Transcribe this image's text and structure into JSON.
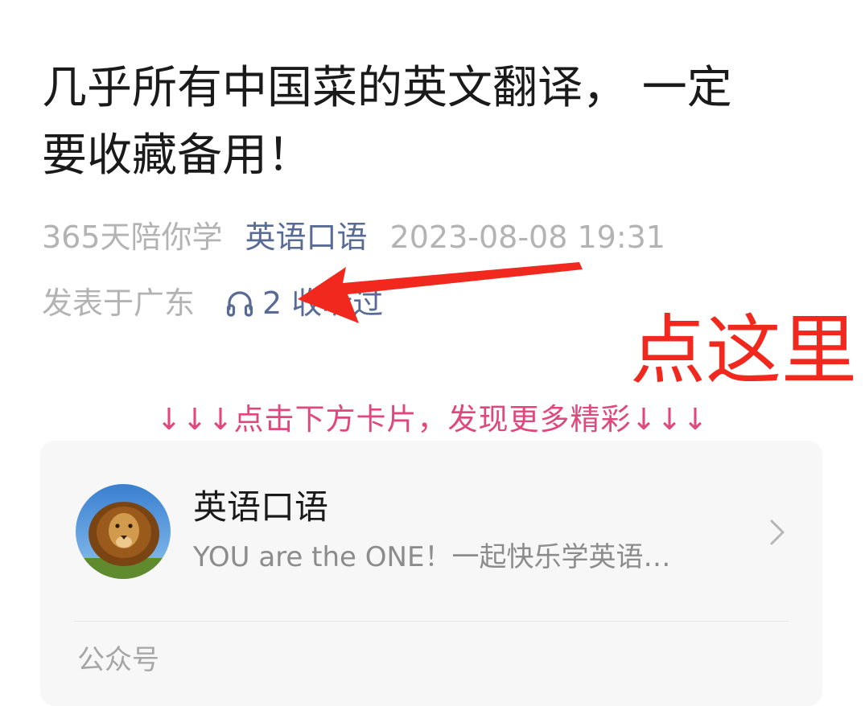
{
  "article": {
    "title_line1": "几乎所有中国菜的英文翻译， 一定",
    "title_line2": "要收藏备用！",
    "author": "365天陪你学",
    "account_link": "英语口语",
    "datetime": "2023-08-08 19:31",
    "location": "发表于广东",
    "listen_text": "2 收听过"
  },
  "annotation": {
    "callout": "点这里",
    "arrow_color": "#f0281e"
  },
  "hint": {
    "text": "↓↓↓点击下方卡片，发现更多精彩↓↓↓",
    "color": "#e0477a"
  },
  "profile_card": {
    "name": "英语口语",
    "description": "YOU are the ONE！一起快乐学英语…",
    "type_label": "公众号",
    "avatar_icon": "lion-avatar-icon",
    "chevron_icon": "chevron-right-icon"
  },
  "colors": {
    "link": "#576b95",
    "meta_gray": "#b3b3b3",
    "card_bg": "#f7f7f7"
  }
}
